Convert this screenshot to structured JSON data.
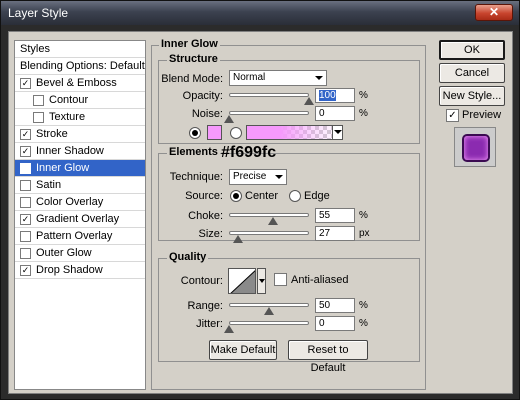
{
  "window": {
    "title": "Layer Style",
    "close_glyph": "✕"
  },
  "style_list": {
    "header": "Styles",
    "blending_options": "Blending Options: Default",
    "items": [
      {
        "label": "Bevel & Emboss",
        "checked": true,
        "indent": false,
        "selected": false,
        "check": "✓"
      },
      {
        "label": "Contour",
        "checked": false,
        "indent": true,
        "selected": false,
        "check": ""
      },
      {
        "label": "Texture",
        "checked": false,
        "indent": true,
        "selected": false,
        "check": ""
      },
      {
        "label": "Stroke",
        "checked": true,
        "indent": false,
        "selected": false,
        "check": "✓"
      },
      {
        "label": "Inner Shadow",
        "checked": true,
        "indent": false,
        "selected": false,
        "check": "✓"
      },
      {
        "label": "Inner Glow",
        "checked": true,
        "indent": false,
        "selected": true,
        "check": "✓"
      },
      {
        "label": "Satin",
        "checked": false,
        "indent": false,
        "selected": false,
        "check": ""
      },
      {
        "label": "Color Overlay",
        "checked": false,
        "indent": false,
        "selected": false,
        "check": ""
      },
      {
        "label": "Gradient Overlay",
        "checked": true,
        "indent": false,
        "selected": false,
        "check": "✓"
      },
      {
        "label": "Pattern Overlay",
        "checked": false,
        "indent": false,
        "selected": false,
        "check": ""
      },
      {
        "label": "Outer Glow",
        "checked": false,
        "indent": false,
        "selected": false,
        "check": ""
      },
      {
        "label": "Drop Shadow",
        "checked": true,
        "indent": false,
        "selected": false,
        "check": "✓"
      }
    ]
  },
  "inner_glow": {
    "title": "Inner Glow",
    "structure": {
      "title": "Structure",
      "blend_mode_label": "Blend Mode:",
      "blend_mode_value": "Normal",
      "opacity_label": "Opacity:",
      "opacity_value": "100",
      "opacity_unit": "%",
      "opacity_level": 1.0,
      "noise_label": "Noise:",
      "noise_value": "0",
      "noise_unit": "%",
      "noise_level": 0.0,
      "glow_color": "#f699fc"
    },
    "elements": {
      "title": "Elements",
      "annotation": "#f699fc",
      "technique_label": "Technique:",
      "technique_value": "Precise",
      "source_label": "Source:",
      "source_center": "Center",
      "source_edge": "Edge",
      "choke_label": "Choke:",
      "choke_value": "55",
      "choke_unit": "%",
      "choke_level": 0.55,
      "size_label": "Size:",
      "size_value": "27",
      "size_unit": "px",
      "size_level": 0.11
    },
    "quality": {
      "title": "Quality",
      "contour_label": "Contour:",
      "antialiased_label": "Anti-aliased",
      "range_label": "Range:",
      "range_value": "50",
      "range_unit": "%",
      "range_level": 0.5,
      "jitter_label": "Jitter:",
      "jitter_value": "0",
      "jitter_unit": "%",
      "jitter_level": 0.0
    },
    "make_default": "Make Default",
    "reset_default": "Reset to Default"
  },
  "buttons": {
    "ok": "OK",
    "cancel": "Cancel",
    "new_style": "New Style...",
    "preview": "Preview",
    "preview_check": "✓"
  },
  "colors": {
    "accent": "#3264c8",
    "glow": "#f699fc",
    "preview": "#8b2bb0"
  }
}
